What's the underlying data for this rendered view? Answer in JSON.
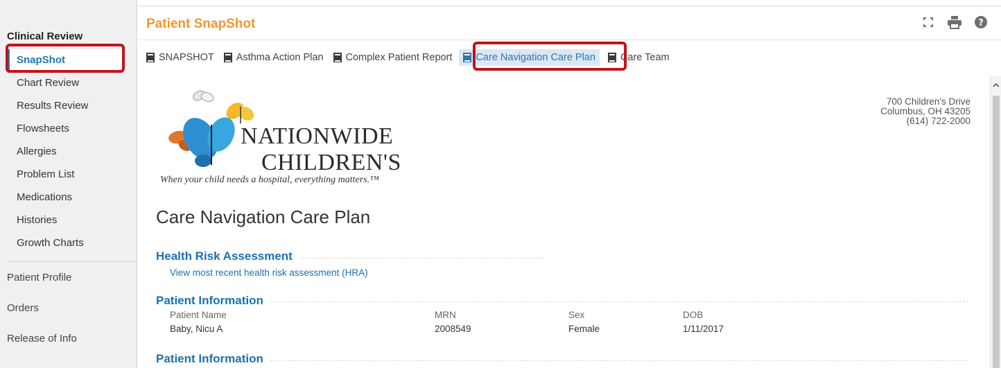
{
  "sidebar": {
    "section_title": "Clinical Review",
    "active_item": "SnapShot",
    "items": [
      {
        "label": "Chart Review"
      },
      {
        "label": "Results Review"
      },
      {
        "label": "Flowsheets"
      },
      {
        "label": "Allergies"
      },
      {
        "label": "Problem List"
      },
      {
        "label": "Medications"
      },
      {
        "label": "Histories"
      },
      {
        "label": "Growth Charts"
      }
    ],
    "groups": [
      {
        "label": "Patient Profile"
      },
      {
        "label": "Orders"
      },
      {
        "label": "Release of Info"
      }
    ]
  },
  "header": {
    "title": "Patient SnapShot",
    "icons": [
      "expand-icon",
      "print-icon",
      "help-icon"
    ]
  },
  "tabs": [
    {
      "label": "SNAPSHOT"
    },
    {
      "label": "Asthma Action Plan"
    },
    {
      "label": "Complex Patient Report"
    },
    {
      "label": "Care Navigation Care Plan",
      "active": true
    },
    {
      "label": "Care Team"
    }
  ],
  "document": {
    "address": {
      "line1": "700 Children's Drive",
      "line2": "Columbus, OH 43205",
      "line3": "(614) 722-2000"
    },
    "logo": {
      "word1": "NATIONWIDE",
      "word2": "CHILDREN'S",
      "tagline": "When your child needs a hospital, everything matters.™"
    },
    "heading": "Care Navigation Care Plan",
    "hra": {
      "title": "Health Risk Assessment",
      "link": "View most recent health risk assessment (HRA)"
    },
    "patient_info": {
      "title": "Patient Information",
      "labels": {
        "name": "Patient Name",
        "mrn": "MRN",
        "sex": "Sex",
        "dob": "DOB"
      },
      "values": {
        "name": "Baby, Nicu A",
        "mrn": "2008549",
        "sex": "Female",
        "dob": "1/11/2017"
      }
    },
    "patient_info_2": {
      "title": "Patient Information"
    }
  },
  "colors": {
    "accent_orange": "#f0962d",
    "link_blue": "#1d6fae",
    "highlight_red": "#c0141c",
    "active_tab_bg": "#dbe8f4"
  }
}
